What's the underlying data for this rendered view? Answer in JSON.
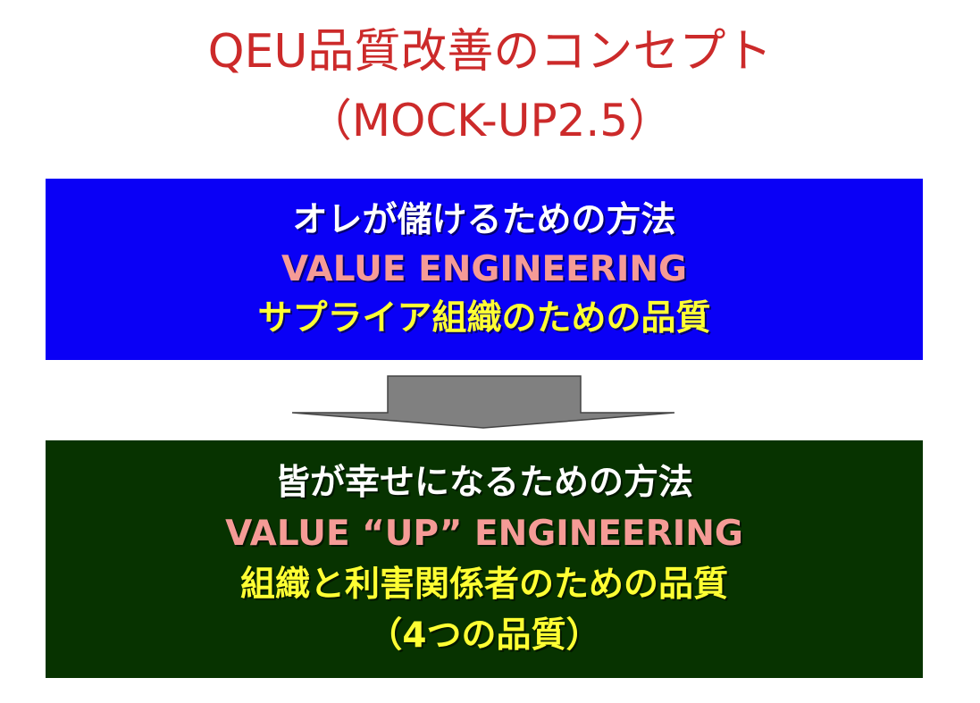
{
  "title": {
    "line1": "QEU品質改善のコンセプト",
    "line2": "（MOCK-UP2.5）"
  },
  "top_box": {
    "line1": "オレが儲けるための方法",
    "line2": "VALUE ENGINEERING",
    "line3": "サプライア組織のための品質"
  },
  "bottom_box": {
    "line1": "皆が幸せになるための方法",
    "line2": "VALUE “UP” ENGINEERING",
    "line3": "組織と利害関係者のための品質",
    "line4": "（4つの品質）"
  },
  "colors": {
    "title": "#cc2a2a",
    "top_box_bg": "#0a00f6",
    "bottom_box_bg": "#073300",
    "arrow": "#808080",
    "text_white": "#ffffff",
    "text_pink": "#f59b96",
    "text_yellow": "#ffff33"
  },
  "icons": {
    "arrow": "down-arrow-icon"
  }
}
